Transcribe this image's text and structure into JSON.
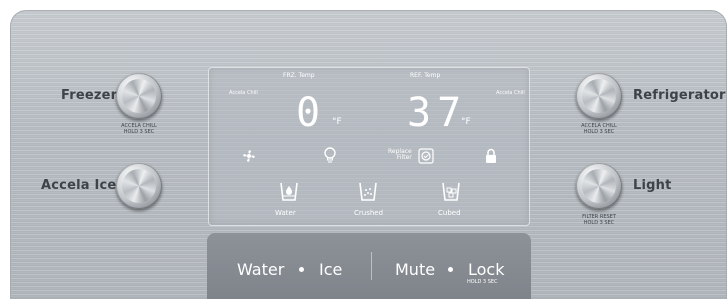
{
  "panel": {
    "left_controls": {
      "freezer": {
        "label": "Freezer",
        "hold_line1": "ACCELA CHILL",
        "hold_line2": "HOLD 3 SEC"
      },
      "accela_ice": {
        "label": "Accela Ice"
      }
    },
    "right_controls": {
      "refrigerator": {
        "label": "Refrigerator",
        "hold_line1": "ACCELA CHILL",
        "hold_line2": "HOLD 3 SEC"
      },
      "light": {
        "label": "Light",
        "hold_line1": "FILTER RESET",
        "hold_line2": "HOLD 3 SEC"
      }
    },
    "display": {
      "frz_title": "FRZ. Temp",
      "ref_title": "REF. Temp",
      "accela_left": "Accela Chill",
      "accela_right": "Accela Chill",
      "freezer_temp": "0",
      "fridge_temp": "37",
      "unit_left": "°F",
      "unit_right": "°F",
      "replace_filter_line1": "Replace",
      "replace_filter_line2": "Filter",
      "dispense": {
        "water": "Water",
        "crushed": "Crushed",
        "cubed": "Cubed"
      }
    },
    "bottom": {
      "water": "Water",
      "ice": "Ice",
      "mute": "Mute",
      "lock": "Lock",
      "lock_hold": "HOLD 3 SEC"
    },
    "icons": {
      "fan": "fan-icon",
      "bulb": "light-bulb-icon",
      "filter": "filter-icon",
      "lock": "lock-icon",
      "water": "water-cup-icon",
      "crushed": "crushed-ice-cup-icon",
      "cubed": "cubed-ice-cup-icon"
    }
  }
}
